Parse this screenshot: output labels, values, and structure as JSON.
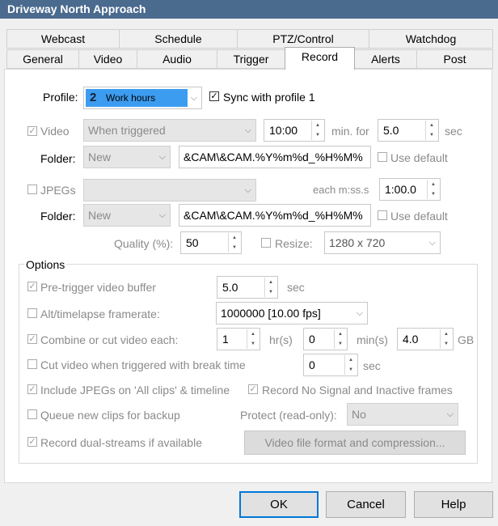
{
  "window": {
    "title": "Driveway North Approach"
  },
  "tabs_row1": [
    "Webcast",
    "Schedule",
    "PTZ/Control",
    "Watchdog"
  ],
  "tabs_row2": [
    "General",
    "Video",
    "Audio",
    "Trigger",
    "Record",
    "Alerts",
    "Post"
  ],
  "active_tab": "Record",
  "profile": {
    "label": "Profile:",
    "number": "2",
    "value": "Work hours",
    "sync_label": "Sync with profile 1",
    "sync_checked": true
  },
  "video": {
    "label": "Video",
    "checked": true,
    "mode": "When triggered",
    "duration": "10:00",
    "min_for_label": "min. for",
    "seconds": "5.0",
    "sec_label": "sec",
    "folder_label": "Folder:",
    "folder": "New",
    "path": "&CAM\\&CAM.%Y%m%d_%H%M%",
    "use_default_label": "Use default"
  },
  "jpegs": {
    "label": "JPEGs",
    "checked": false,
    "mode": "",
    "each_label": "each m:ss.s",
    "each_value": "1:00.0",
    "folder_label": "Folder:",
    "folder": "New",
    "path": "&CAM\\&CAM.%Y%m%d_%H%M%",
    "use_default_label": "Use default",
    "quality_label": "Quality (%):",
    "quality": "50",
    "resize_label": "Resize:",
    "resize_value": "1280 x 720"
  },
  "options": {
    "title": "Options",
    "pretrigger_label": "Pre-trigger video buffer",
    "pretrigger_value": "5.0",
    "pretrigger_unit": "sec",
    "alt_label": "Alt/timelapse framerate:",
    "alt_value": "1000000 [10.00 fps]",
    "combine_label": "Combine or cut video each:",
    "combine_hr": "1",
    "hr_unit": "hr(s)",
    "combine_min": "0",
    "min_unit": "min(s)",
    "combine_gb": "4.0",
    "gb_unit": "GB",
    "cut_label": "Cut video when triggered with break time",
    "cut_value": "0",
    "cut_unit": "sec",
    "include_jpegs_label": "Include JPEGs on 'All clips' & timeline",
    "record_nosignal_label": "Record No Signal and Inactive frames",
    "queue_label": "Queue new clips for backup",
    "protect_label": "Protect (read-only):",
    "protect_value": "No",
    "dual_label": "Record dual-streams if available",
    "format_button": "Video file format and compression..."
  },
  "buttons": {
    "ok": "OK",
    "cancel": "Cancel",
    "help": "Help"
  },
  "colors": {
    "titlebar": "#4a6a8e",
    "profile_highlight": "#3c9cf0",
    "default_border": "#0078d7"
  }
}
